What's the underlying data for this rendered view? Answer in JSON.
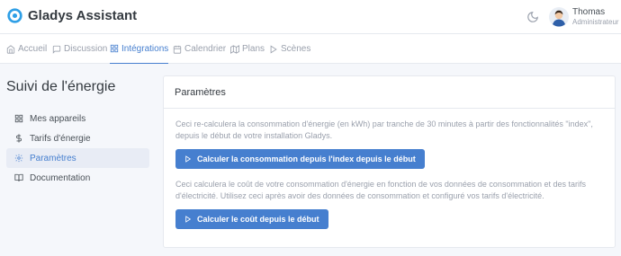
{
  "header": {
    "brand": "Gladys Assistant",
    "user_name": "Thomas",
    "user_role": "Administrateur"
  },
  "nav": {
    "items": [
      {
        "label": "Accueil",
        "icon": "home-icon"
      },
      {
        "label": "Discussion",
        "icon": "message-square-icon"
      },
      {
        "label": "Intégrations",
        "icon": "grid-icon",
        "active": true
      },
      {
        "label": "Calendrier",
        "icon": "calendar-icon"
      },
      {
        "label": "Plans",
        "icon": "map-icon"
      },
      {
        "label": "Scènes",
        "icon": "play-icon"
      }
    ]
  },
  "sidebar": {
    "title": "Suivi de l'énergie",
    "items": [
      {
        "label": "Mes appareils",
        "icon": "grid-icon"
      },
      {
        "label": "Tarifs d'énergie",
        "icon": "dollar-icon"
      },
      {
        "label": "Paramètres",
        "icon": "settings-icon",
        "active": true
      },
      {
        "label": "Documentation",
        "icon": "book-open-icon"
      }
    ]
  },
  "main": {
    "card_title": "Paramètres",
    "desc1": "Ceci re-calculera la consommation d'énergie (en kWh) par tranche de 30 minutes à partir des fonctionnalités \"index\", depuis le début de votre installation Gladys.",
    "btn1": "Calculer la consommation depuis l'index depuis le début",
    "desc2": "Ceci calculera le coût de votre consommation d'énergie en fonction de vos données de consommation et des tarifs d'électricité. Utilisez ceci après avoir des données de consommation et configuré vos tarifs d'électricité.",
    "btn2": "Calculer le coût depuis le début"
  },
  "colors": {
    "accent": "#467fcf",
    "background": "#f5f7fb",
    "muted_text": "#9aa0ac"
  }
}
